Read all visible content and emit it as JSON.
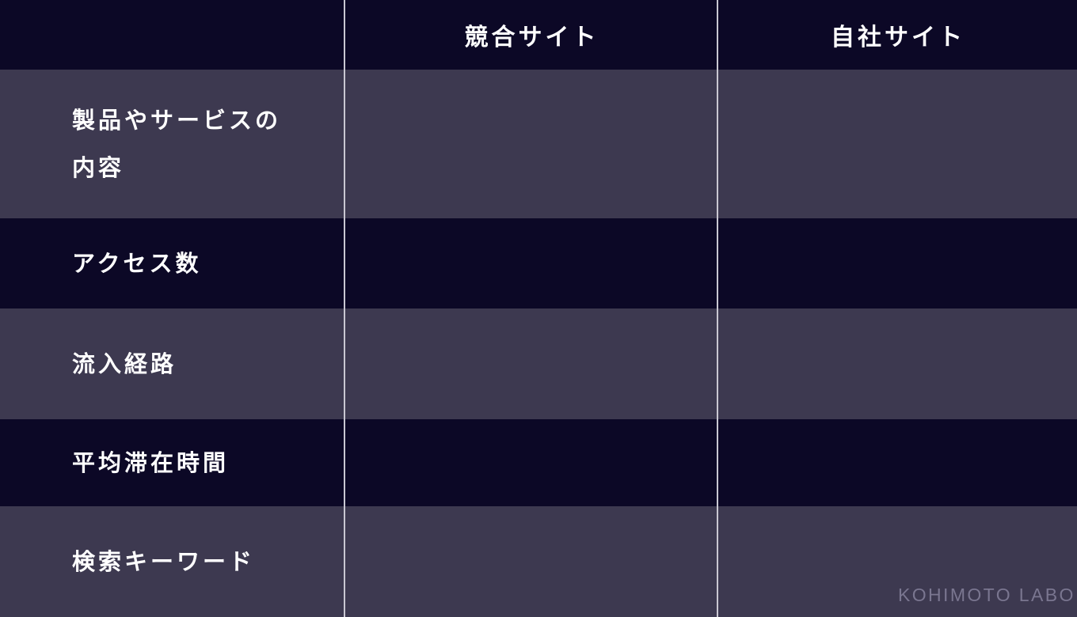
{
  "header": {
    "columns": [
      "",
      "競合サイト",
      "自社サイト"
    ]
  },
  "rows": [
    {
      "label": "製品やサービスの内容"
    },
    {
      "label": "アクセス数"
    },
    {
      "label": "流入経路"
    },
    {
      "label": "平均滞在時間"
    },
    {
      "label": "検索キーワード"
    }
  ],
  "watermark": "KOHIMOTO LABO",
  "colors": {
    "dark_row": "#0c0826",
    "light_row": "#3d3950",
    "divider": "#c9c7d2",
    "text": "#ffffff",
    "watermark": "#7a7690"
  }
}
